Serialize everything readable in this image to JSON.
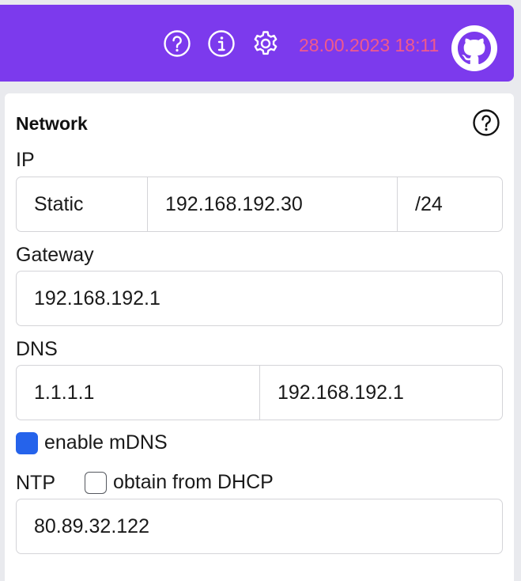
{
  "header": {
    "datetime": "28.00.2023 18:11",
    "icons": [
      "help-icon",
      "info-icon",
      "gear-icon",
      "github-icon"
    ],
    "background": "#7c3aed",
    "datetime_color": "#f05a8c"
  },
  "network": {
    "title": "Network",
    "ip": {
      "label": "IP",
      "mode": "Static",
      "address": "192.168.192.30",
      "prefix": "/24"
    },
    "gateway": {
      "label": "Gateway",
      "value": "192.168.192.1"
    },
    "dns": {
      "label": "DNS",
      "primary": "1.1.1.1",
      "secondary": "192.168.192.1"
    },
    "mdns": {
      "label": "enable mDNS",
      "checked": true
    },
    "ntp": {
      "label": "NTP",
      "dhcp_label": "obtain from DHCP",
      "dhcp_checked": false,
      "value": "80.89.32.122"
    },
    "checkbox_color": "#2563eb"
  }
}
